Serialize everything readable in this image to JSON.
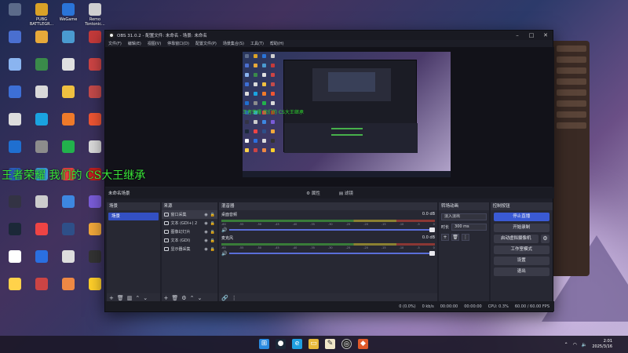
{
  "desktop": {
    "icons": [
      {
        "label": "",
        "color": "#5c6b8a"
      },
      {
        "label": "PUBG BATTLEGR...",
        "color": "#d9a227"
      },
      {
        "label": "WeGame",
        "color": "#2a74d8"
      },
      {
        "label": "Remo Tontonic...",
        "color": "#cfcfcf"
      },
      {
        "label": "",
        "color": "#4a6fd0"
      },
      {
        "label": "",
        "color": "#e7a93a"
      },
      {
        "label": "",
        "color": "#4a9ad0"
      },
      {
        "label": "",
        "color": "#c43a3a"
      },
      {
        "label": "",
        "color": "#8ab4f0"
      },
      {
        "label": "",
        "color": "#3a8a4a"
      },
      {
        "label": "",
        "color": "#e0e0e0"
      },
      {
        "label": "",
        "color": "#c44"
      },
      {
        "label": "",
        "color": "#3d6fd6"
      },
      {
        "label": "",
        "color": "#d9d9d9"
      },
      {
        "label": "",
        "color": "#f0c040"
      },
      {
        "label": "",
        "color": "#c44a4a"
      },
      {
        "label": "",
        "color": "#ddd"
      },
      {
        "label": "",
        "color": "#1aa3e0"
      },
      {
        "label": "",
        "color": "#ef7a2a"
      },
      {
        "label": "",
        "color": "#e53"
      },
      {
        "label": "",
        "color": "#1f6fd0"
      },
      {
        "label": "",
        "color": "#8c8c8c"
      },
      {
        "label": "",
        "color": "#22b24c"
      },
      {
        "label": "",
        "color": "#dadada"
      },
      {
        "label": "",
        "color": "#2b5db8"
      },
      {
        "label": "",
        "color": "#3a9cd8"
      },
      {
        "label": "",
        "color": "#e84040"
      },
      {
        "label": "",
        "color": "#c02020"
      },
      {
        "label": "",
        "color": "#334"
      },
      {
        "label": "",
        "color": "#ccc"
      },
      {
        "label": "",
        "color": "#3d87e0"
      },
      {
        "label": "",
        "color": "#7a5cd8"
      },
      {
        "label": "",
        "color": "#1b2838"
      },
      {
        "label": "",
        "color": "#e44"
      },
      {
        "label": "",
        "color": "#2e4f88"
      },
      {
        "label": "",
        "color": "#f2a93b"
      },
      {
        "label": "",
        "color": "#fff"
      },
      {
        "label": "",
        "color": "#2a6fe0"
      },
      {
        "label": "",
        "color": "#ddd"
      },
      {
        "label": "",
        "color": "#333"
      },
      {
        "label": "",
        "color": "#ffd24a"
      },
      {
        "label": "",
        "color": "#c44"
      },
      {
        "label": "",
        "color": "#e84"
      },
      {
        "label": "",
        "color": "#ffcf2a"
      }
    ]
  },
  "obs": {
    "window_title": "OBS 31.0.2 - 配置文件: 未命名 - 场景: 未命名",
    "menu": [
      "文件(F)",
      "编辑(E)",
      "视图(V)",
      "停靠窗口(D)",
      "配置文件(P)",
      "场景集合(S)",
      "工具(T)",
      "帮助(H)"
    ],
    "overlay_text": "王者荣耀 我们的 CS大王继承",
    "preview_text": "王者荣耀 我们的 CS大王继承",
    "toolbar_tabs": {
      "scene_label": "未命名场景",
      "props": "属性",
      "filters": "滤镜"
    },
    "scenes": {
      "title": "场景",
      "items": [
        "场景"
      ]
    },
    "sources": {
      "title": "来源",
      "items": [
        "窗口采集",
        "文本 (GDI+) 2",
        "图像幻灯片",
        "文本 (GDI)",
        "显示器采集"
      ]
    },
    "mixer": {
      "title": "混音器",
      "channels": [
        {
          "name": "桌面音频",
          "level": "0.0 dB"
        },
        {
          "name": "麦克风",
          "level": "0.0 dB"
        }
      ],
      "scale": [
        "-60",
        "-55",
        "-50",
        "-45",
        "-40",
        "-35",
        "-30",
        "-25",
        "-20",
        "-15",
        "-10",
        "-5",
        "0"
      ]
    },
    "transitions": {
      "title": "转场动画",
      "selected": "淡入淡出",
      "duration_label": "时长",
      "duration": "300 ms"
    },
    "controls": {
      "title": "控制按钮",
      "stop_stream": "停止直播",
      "start_record": "开始录制",
      "virtual_cam": "启动虚拟摄像机",
      "studio_mode": "工作室模式",
      "settings": "设置",
      "exit": "退出"
    },
    "status": {
      "dropped": "0 (0.0%)",
      "bitrate": "0 kb/s",
      "stream_time": "00:00:00",
      "rec_time": "00:00:00",
      "cpu": "CPU: 0.3%",
      "fps": "60.00 / 60.00 FPS"
    }
  },
  "taskbar": {
    "clock_time": "2:01",
    "clock_date": "2025/3/16",
    "icons": [
      "start-icon",
      "steam-icon",
      "edge-icon",
      "explorer-icon",
      "notes-icon",
      "obs-icon",
      "app-icon"
    ]
  }
}
